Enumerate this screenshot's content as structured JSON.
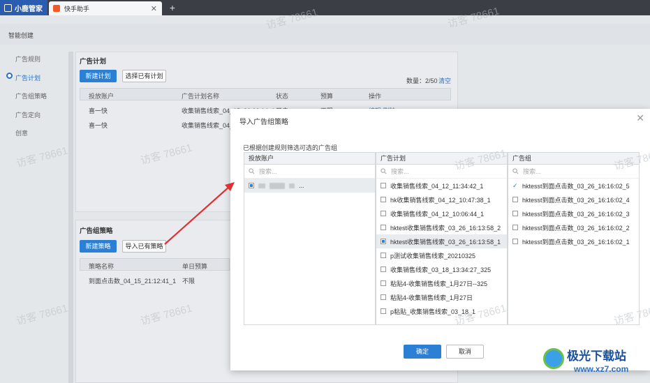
{
  "browser": {
    "brand": "小鹿管家",
    "tab_title": "快手助手",
    "tab_close": "✕",
    "new_tab": "+"
  },
  "app": {
    "page_title": "智能创建",
    "nav": [
      "广告规则",
      "广告计划",
      "广告组策略",
      "广告定向",
      "创意"
    ],
    "plan_section": {
      "title": "广告计划",
      "new_button": "新建计划",
      "select_button": "选择已有计划",
      "count_label": "数量：2/50",
      "clear_link": "清空",
      "headers": [
        "投放账户",
        "广告计划名称",
        "状态",
        "预算",
        "操作"
      ],
      "rows": [
        [
          "喜一快",
          "收集销售线索_04_15_20:00:14_1",
          "开启",
          "不限",
          "编辑 删除"
        ],
        [
          "喜一快",
          "收集销售线索_04_1",
          "",
          "",
          ""
        ]
      ]
    },
    "strategy_section": {
      "title": "广告组策略",
      "new_button": "新建策略",
      "import_button": "导入已有策略",
      "headers": [
        "策略名称",
        "单日预算"
      ],
      "rows": [
        [
          "到面点击数_04_15_21:12:41_1",
          "不限"
        ]
      ]
    }
  },
  "watermark": "访客 78661",
  "modal": {
    "title": "导入广告组策略",
    "close": "✕",
    "hint": "已根据创建规则筛选可选的广告组",
    "search_placeholder": "搜索...",
    "columns": {
      "accounts": {
        "header": "投放账户",
        "items": [
          {
            "label": "...",
            "checked": "partial",
            "selected": true
          }
        ]
      },
      "plans": {
        "header": "广告计划",
        "items": [
          {
            "label": "收集销售线索_04_12_11:34:42_1",
            "checked": "none"
          },
          {
            "label": "hk收集销售线索_04_12_10:47:38_1",
            "checked": "none"
          },
          {
            "label": "收集销售线索_04_12_10:06:44_1",
            "checked": "none"
          },
          {
            "label": "hktest收集销售线索_03_26_16:13:58_2",
            "checked": "none"
          },
          {
            "label": "hktest收集销售线索_03_26_16:13:58_1",
            "checked": "partial",
            "selected": true
          },
          {
            "label": "p测试收集销售线索_20210325",
            "checked": "none"
          },
          {
            "label": "收集销售线索_03_18_13:34:27_325",
            "checked": "none"
          },
          {
            "label": "粘贴4-收集销售线索_1月27日--325",
            "checked": "none"
          },
          {
            "label": "粘贴4-收集销售线索_1月27日",
            "checked": "none"
          },
          {
            "label": "p粘贴_收集销售线索_03_18_1",
            "checked": "none"
          }
        ]
      },
      "groups": {
        "header": "广告组",
        "items": [
          {
            "label": "hktesst到面点击数_03_26_16:16:02_5",
            "checked": "checked"
          },
          {
            "label": "hktesst到面点击数_03_26_16:16:02_4",
            "checked": "none"
          },
          {
            "label": "hktesst到面点击数_03_26_16:16:02_3",
            "checked": "none"
          },
          {
            "label": "hktesst到面点击数_03_26_16:16:02_2",
            "checked": "none"
          },
          {
            "label": "hktesst到面点击数_03_26_16:16:02_1",
            "checked": "none"
          }
        ]
      }
    },
    "ok_button": "确定",
    "cancel_button": "取消"
  },
  "site_badge": {
    "name": "极光下载站",
    "url": "www.xz7.com"
  },
  "colors": {
    "accent": "#2b7fd4",
    "arrow": "#e03030",
    "brand": "#2a5db0"
  }
}
